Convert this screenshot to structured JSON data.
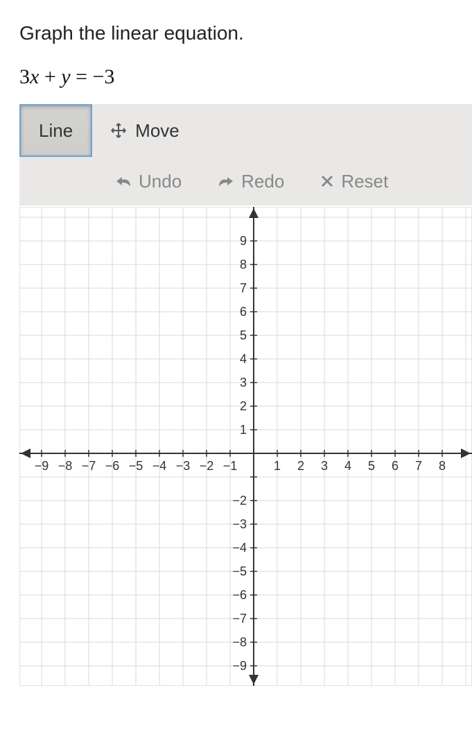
{
  "prompt": "Graph the linear equation.",
  "equation_latex": "3x + y = −3",
  "toolbar": {
    "line_label": "Line",
    "move_label": "Move",
    "undo_label": "Undo",
    "redo_label": "Redo",
    "reset_label": "Reset"
  },
  "chart_data": {
    "type": "line",
    "title": "",
    "xlabel": "",
    "ylabel": "",
    "xlim": [
      -9,
      8
    ],
    "ylim": [
      -9,
      9
    ],
    "x_ticks": [
      -9,
      -8,
      -7,
      -6,
      -5,
      -4,
      -3,
      -2,
      -1,
      1,
      2,
      3,
      4,
      5,
      6,
      7,
      8
    ],
    "y_ticks": [
      -9,
      -8,
      -7,
      -6,
      -5,
      -4,
      -3,
      -2,
      1,
      2,
      3,
      4,
      5,
      6,
      7,
      8,
      9
    ],
    "series": []
  }
}
